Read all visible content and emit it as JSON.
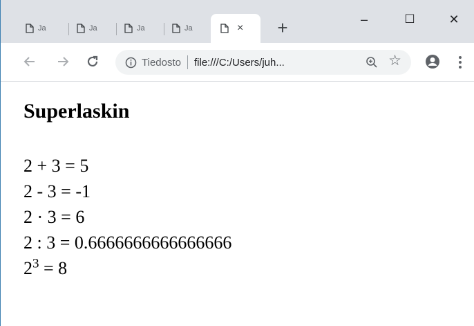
{
  "browser": {
    "tabs": [
      {
        "label": "Ja"
      },
      {
        "label": "Ja"
      },
      {
        "label": "Ja"
      },
      {
        "label": "Ja"
      }
    ],
    "active_tab": {
      "close": "×"
    },
    "new_tab": "+",
    "window_controls": {
      "minimize": "–",
      "maximize": "☐",
      "close": "✕"
    },
    "address": {
      "origin_label": "Tiedosto",
      "url": "file:///C:/Users/juh..."
    },
    "icons": [
      "page-icon",
      "back-icon",
      "forward-icon",
      "reload-icon",
      "info-icon",
      "zoom-icon",
      "star-icon",
      "profile-icon",
      "menu-icon"
    ]
  },
  "page": {
    "title": "Superlaskin",
    "lines": [
      "2 + 3 = 5",
      "2 - 3 = -1",
      "2 · 3 = 6",
      "2 : 3 = 0.6666666666666666"
    ],
    "power": {
      "base": "2",
      "exponent": "3",
      "rest": " = 8"
    }
  }
}
